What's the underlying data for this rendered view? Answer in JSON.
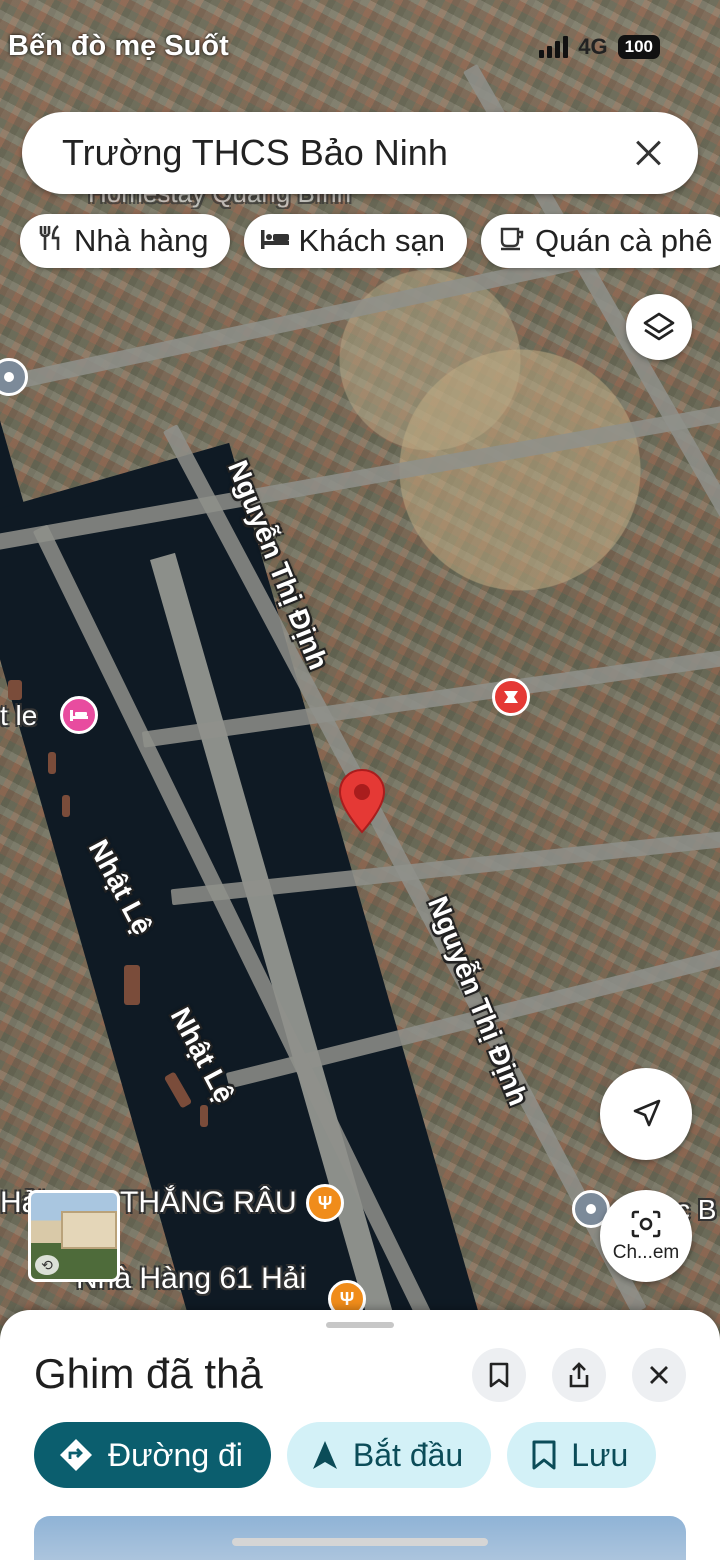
{
  "status_bar": {
    "carrier": "Bến đò mẹ Suốt",
    "network": "4G",
    "battery": "100"
  },
  "search": {
    "query": "Trường THCS Bảo Ninh"
  },
  "chips": [
    {
      "icon": "restaurant-icon",
      "label": "Nhà hàng"
    },
    {
      "icon": "hotel-icon",
      "label": "Khách sạn"
    },
    {
      "icon": "cafe-icon",
      "label": "Quán cà phê"
    }
  ],
  "map": {
    "streets": [
      "Nguyễn Thị Định",
      "Nguyễn Thị Định",
      "Nhật Lệ",
      "Nhật Lệ"
    ],
    "pois": {
      "top_label": "Homestay Quảng Bình",
      "hotel_partial": "t le",
      "restaurant_1": "Hải",
      "restaurant_1b": "THẮNG RÂU",
      "restaurant_2": "Nhà Hàng 61 Hải",
      "right_partial": "c B"
    },
    "pin_color": "#e53935"
  },
  "fab": {
    "lens_label": "Ch...em"
  },
  "sheet": {
    "title": "Ghim đã thả",
    "actions": [
      {
        "icon": "directions-icon",
        "label": "Đường đi"
      },
      {
        "icon": "navigation-arrow-icon",
        "label": "Bắt đầu"
      },
      {
        "icon": "bookmark-icon",
        "label": "Lưu"
      }
    ]
  },
  "colors": {
    "primary_action": "#0b5e6e",
    "secondary_action": "#d3f1f7",
    "pin_red": "#e53935",
    "hotel_pink": "#e84c9f",
    "restaurant_orange": "#f08c1a"
  }
}
